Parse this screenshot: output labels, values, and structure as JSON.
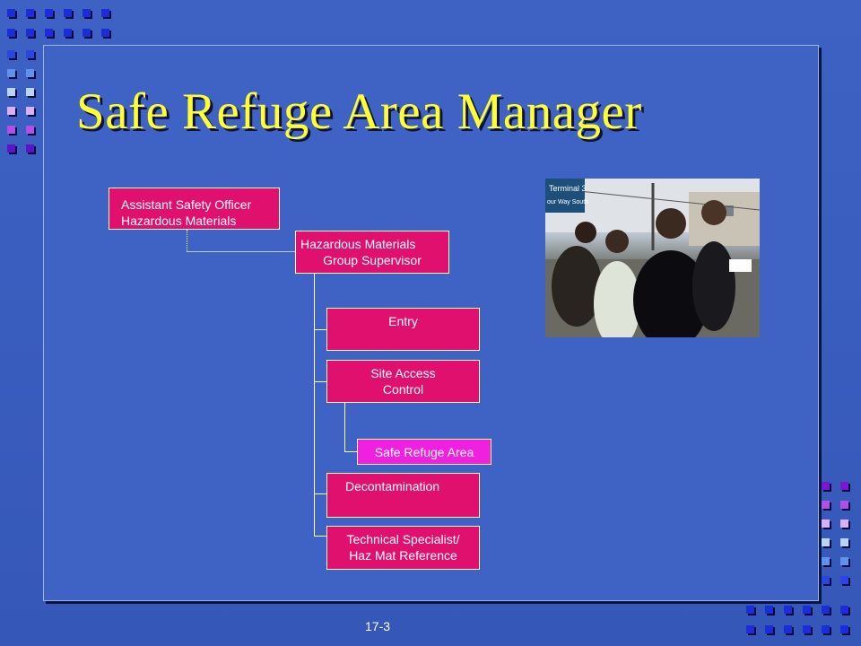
{
  "slide": {
    "title": "Safe Refuge Area Manager",
    "page_number": "17-3"
  },
  "org_chart": {
    "assistant_safety_officer": {
      "line1": "Assistant Safety Officer",
      "line2": "Hazardous Materials"
    },
    "group_supervisor": {
      "line1": "Hazardous Materials",
      "line2": "Group Supervisor"
    },
    "entry": {
      "label": "Entry"
    },
    "site_access_control": {
      "line1": "Site Access",
      "line2": "Control"
    },
    "safe_refuge_area": {
      "label": "Safe Refuge Area"
    },
    "decontamination": {
      "label": "Decontamination"
    },
    "technical_specialist": {
      "line1": "Technical Specialist/",
      "line2": "Haz Mat Reference"
    }
  },
  "photo": {
    "sign_line1": "Terminal 3",
    "sign_line2": "our Way South"
  },
  "colors": {
    "title": "#ffff33",
    "box": "#e0106e",
    "highlight_box": "#f020e0",
    "background": "#3e63c4"
  }
}
